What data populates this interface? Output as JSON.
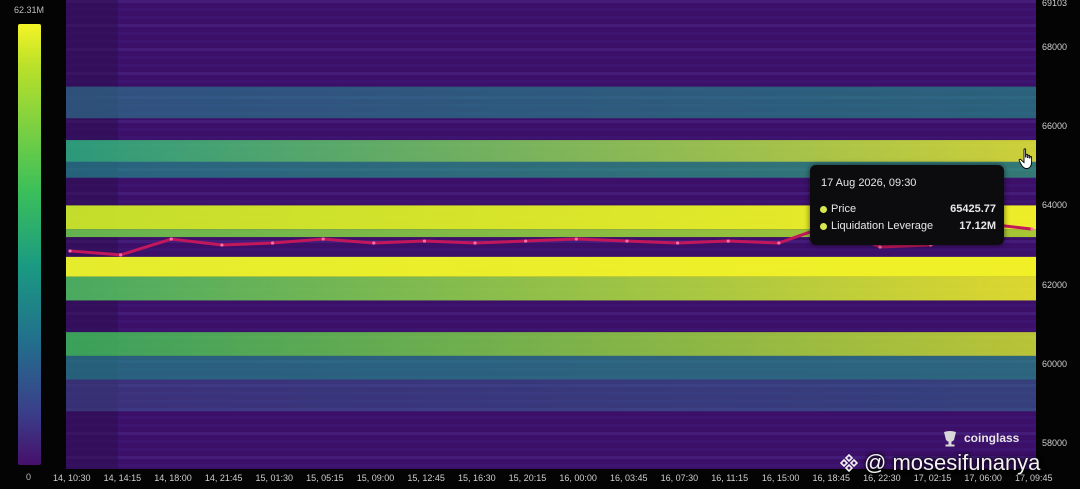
{
  "colorbar": {
    "max_label": "62.31M",
    "min_label": "0",
    "gradient": [
      "#f4f426",
      "#b8e02a",
      "#3bbf5a",
      "#1a9a82",
      "#226f8c",
      "#3a3f8a",
      "#46106b"
    ]
  },
  "chart_data": {
    "type": "heatmap",
    "title": "",
    "xlabel": "",
    "ylabel": "",
    "ylim": [
      57400,
      69103
    ],
    "y_ticks": [
      "69103",
      "68000",
      "66000",
      "64000",
      "62000",
      "60000",
      "58000"
    ],
    "x_ticks": [
      "14, 10:30",
      "14, 14:15",
      "14, 18:00",
      "14, 21:45",
      "15, 01:30",
      "15, 05:15",
      "15, 09:00",
      "15, 12:45",
      "15, 16:30",
      "15, 20:15",
      "16, 00:00",
      "16, 03:45",
      "16, 07:30",
      "16, 11:15",
      "16, 15:00",
      "16, 18:45",
      "16, 22:30",
      "17, 02:15",
      "17, 06:00",
      "17, 09:45"
    ],
    "colors": {
      "low": "#46106b",
      "mid": "#1fa187",
      "high": "#f4f426",
      "price_line": "#c2185b"
    },
    "liquidation_bands": [
      {
        "price_low": 65100,
        "price_high": 65650,
        "intensity_start": 0.6,
        "intensity_end": 0.95,
        "color_start": "#2bb07f",
        "color_end": "#e6f030"
      },
      {
        "price_low": 64700,
        "price_high": 65100,
        "intensity_start": 0.35,
        "intensity_end": 0.55,
        "color_start": "#1f8f8c",
        "color_end": "#2fb47c"
      },
      {
        "price_low": 63400,
        "price_high": 64000,
        "intensity_start": 0.9,
        "intensity_end": 1.0,
        "color_start": "#c8e42a",
        "color_end": "#f4f426"
      },
      {
        "price_low": 63200,
        "price_high": 63400,
        "intensity_start": 0.7,
        "intensity_end": 0.9,
        "color_start": "#6ccb4c",
        "color_end": "#b8e02a"
      },
      {
        "price_low": 62200,
        "price_high": 62700,
        "intensity_start": 0.95,
        "intensity_end": 1.0,
        "color_start": "#e8f02c",
        "color_end": "#f4f426"
      },
      {
        "price_low": 61600,
        "price_high": 62200,
        "intensity_start": 0.6,
        "intensity_end": 1.0,
        "color_start": "#4cc060",
        "color_end": "#f4f426"
      },
      {
        "price_low": 60200,
        "price_high": 60800,
        "intensity_start": 0.55,
        "intensity_end": 0.9,
        "color_start": "#3bbf5a",
        "color_end": "#d4ea2c"
      },
      {
        "price_low": 59600,
        "price_high": 60200,
        "intensity_start": 0.35,
        "intensity_end": 0.5,
        "color_start": "#1f8f8c",
        "color_end": "#24968a"
      },
      {
        "price_low": 66200,
        "price_high": 67000,
        "intensity_start": 0.3,
        "intensity_end": 0.45,
        "color_start": "#2a7c8e",
        "color_end": "#1f9a88"
      },
      {
        "price_low": 58800,
        "price_high": 59600,
        "intensity_start": 0.2,
        "intensity_end": 0.3,
        "color_start": "#3b4f8c",
        "color_end": "#2f6d8e"
      }
    ],
    "price_series": [
      {
        "x": "14, 10:30",
        "y": 62850
      },
      {
        "x": "14, 14:15",
        "y": 62750
      },
      {
        "x": "14, 18:00",
        "y": 63150
      },
      {
        "x": "14, 21:45",
        "y": 63000
      },
      {
        "x": "15, 01:30",
        "y": 63050
      },
      {
        "x": "15, 05:15",
        "y": 63150
      },
      {
        "x": "15, 09:00",
        "y": 63050
      },
      {
        "x": "15, 12:45",
        "y": 63100
      },
      {
        "x": "15, 16:30",
        "y": 63050
      },
      {
        "x": "15, 20:15",
        "y": 63100
      },
      {
        "x": "16, 00:00",
        "y": 63150
      },
      {
        "x": "16, 03:45",
        "y": 63100
      },
      {
        "x": "16, 07:30",
        "y": 63050
      },
      {
        "x": "16, 11:15",
        "y": 63100
      },
      {
        "x": "16, 15:00",
        "y": 63050
      },
      {
        "x": "16, 18:45",
        "y": 63500
      },
      {
        "x": "16, 22:30",
        "y": 62950
      },
      {
        "x": "17, 02:15",
        "y": 63000
      },
      {
        "x": "17, 06:00",
        "y": 63550
      },
      {
        "x": "17, 09:45",
        "y": 63400
      }
    ]
  },
  "tooltip": {
    "date": "17 Aug 2026, 09:30",
    "rows": [
      {
        "label": "Price",
        "value": "65425.77"
      },
      {
        "label": "Liquidation Leverage",
        "value": "17.12M"
      }
    ]
  },
  "brand": {
    "name": "coinglass"
  },
  "watermark": {
    "handle": "@ mosesifunanya"
  }
}
